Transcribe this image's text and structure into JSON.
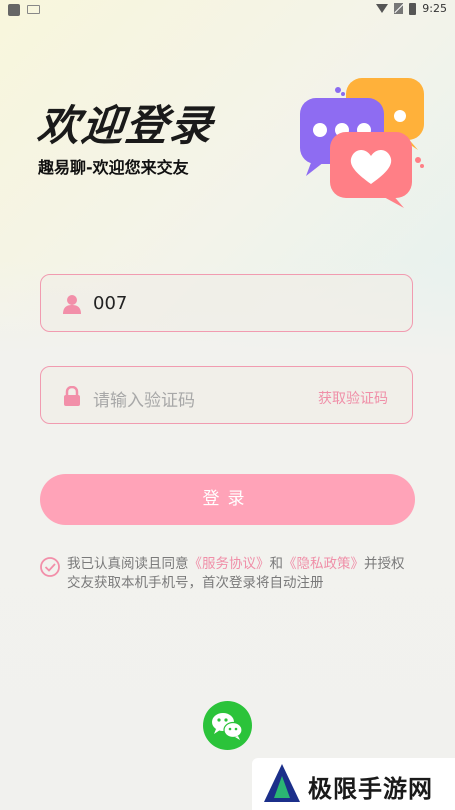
{
  "status_bar": {
    "time": "9:25"
  },
  "header": {
    "title": "欢迎登录",
    "subtitle": "趣易聊-欢迎您来交友"
  },
  "form": {
    "phone_value": "007",
    "code_placeholder": "请输入验证码",
    "get_code_label": "获取验证码",
    "login_label": "登录"
  },
  "agreement": {
    "prefix": "我已认真阅读且同意",
    "service_link": "《服务协议》",
    "and": "和",
    "privacy_link": "《隐私政策》",
    "suffix": "并授权交友获取本机手机号，首次登录将自动注册"
  },
  "watermark": {
    "text": "极限手游网"
  },
  "colors": {
    "accent_pink": "#ffa3b8",
    "border_pink": "#f19bb0",
    "link_pink": "#f08fa8",
    "wechat_green": "#2bc33a"
  },
  "icons": [
    "user-icon",
    "lock-icon",
    "check-circle-icon",
    "wechat-icon",
    "chat-bubbles-illustration",
    "wifi-icon",
    "no-sim-icon",
    "battery-icon"
  ]
}
